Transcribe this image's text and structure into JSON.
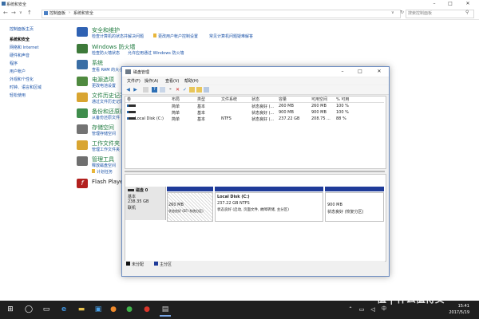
{
  "control_panel": {
    "window_title": "系统和安全",
    "breadcrumb": [
      "控制面板",
      "系统和安全"
    ],
    "search_placeholder": "搜索控制面板",
    "left_nav": [
      "控制面板主页",
      "系统和安全",
      "网络和 Internet",
      "硬件和声音",
      "程序",
      "用户帐户",
      "外观和个性化",
      "时钟、语言和区域",
      "轻松使用"
    ],
    "categories": [
      {
        "title": "安全和维护",
        "links": [
          "检查计算机的状态并解决问题",
          "更改用户帐户控制设置",
          "常见计算机问题疑难解答"
        ],
        "color": "#2f62b3"
      },
      {
        "title": "Windows 防火墙",
        "links": [
          "检查防火墙状态",
          "允许应用通过 Windows 防火墙"
        ],
        "color": "#3d7a3a"
      },
      {
        "title": "系统",
        "links": [
          "查看 RAM 的大小和处理器速度"
        ],
        "color": "#3a6ea5"
      },
      {
        "title": "电源选项",
        "links": [
          "更改电池设置"
        ],
        "color": "#4f8a3f"
      },
      {
        "title": "文件历史记录",
        "links": [
          "通过文件历史记录保存你的文件备份副本"
        ],
        "color": "#d9a531"
      },
      {
        "title": "备份和还原(Wi",
        "links": [
          "从备份还原文件"
        ],
        "color": "#3f8d4c"
      },
      {
        "title": "存储空间",
        "links": [
          "管理存储空间"
        ],
        "color": "#737373"
      },
      {
        "title": "工作文件夹",
        "links": [
          "管理工作文件夹"
        ],
        "color": "#d9a531"
      },
      {
        "title": "管理工具",
        "links": [
          "释放磁盘空间",
          "计划任务"
        ],
        "color": "#6f6f6f"
      },
      {
        "title": "Flash Player",
        "links": [],
        "color": "#b2201e"
      }
    ]
  },
  "disk_mgmt": {
    "title": "磁盘管理",
    "menu": [
      "文件(F)",
      "操作(A)",
      "查看(V)",
      "帮助(H)"
    ],
    "columns": [
      "卷",
      "布局",
      "类型",
      "文件系统",
      "状态",
      "容量",
      "可用空间",
      "% 可用"
    ],
    "rows": [
      {
        "volume": "",
        "layout": "简单",
        "type": "基本",
        "fs": "",
        "status": "状态良好 (...",
        "capacity": "260 MB",
        "free": "260 MB",
        "pct": "100 %"
      },
      {
        "volume": "",
        "layout": "简单",
        "type": "基本",
        "fs": "",
        "status": "状态良好 (...",
        "capacity": "900 MB",
        "free": "900 MB",
        "pct": "100 %"
      },
      {
        "volume": "Local Disk (C:)",
        "layout": "简单",
        "type": "基本",
        "fs": "NTFS",
        "status": "状态良好 (...",
        "capacity": "237.22 GB",
        "free": "208.75 ...",
        "pct": "88 %"
      }
    ],
    "disk": {
      "name": "磁盘 0",
      "type": "基本",
      "size": "238.35 GB",
      "state": "联机"
    },
    "partitions": [
      {
        "name": "",
        "size": "260 MB",
        "status": "状态良好 (EFI 系统分区)"
      },
      {
        "name": "Local Disk (C:)",
        "size": "237.22 GB NTFS",
        "status": "状态良好 (启动, 页面文件, 故障转储, 主分区)"
      },
      {
        "name": "",
        "size": "900 MB",
        "status": "状态良好 (恢复分区)"
      }
    ],
    "legend": [
      "未分配",
      "主分区"
    ]
  },
  "taskbar": {
    "time": "15:41",
    "date": "2017/5/19",
    "watermark": "值 | 什么值得买"
  }
}
